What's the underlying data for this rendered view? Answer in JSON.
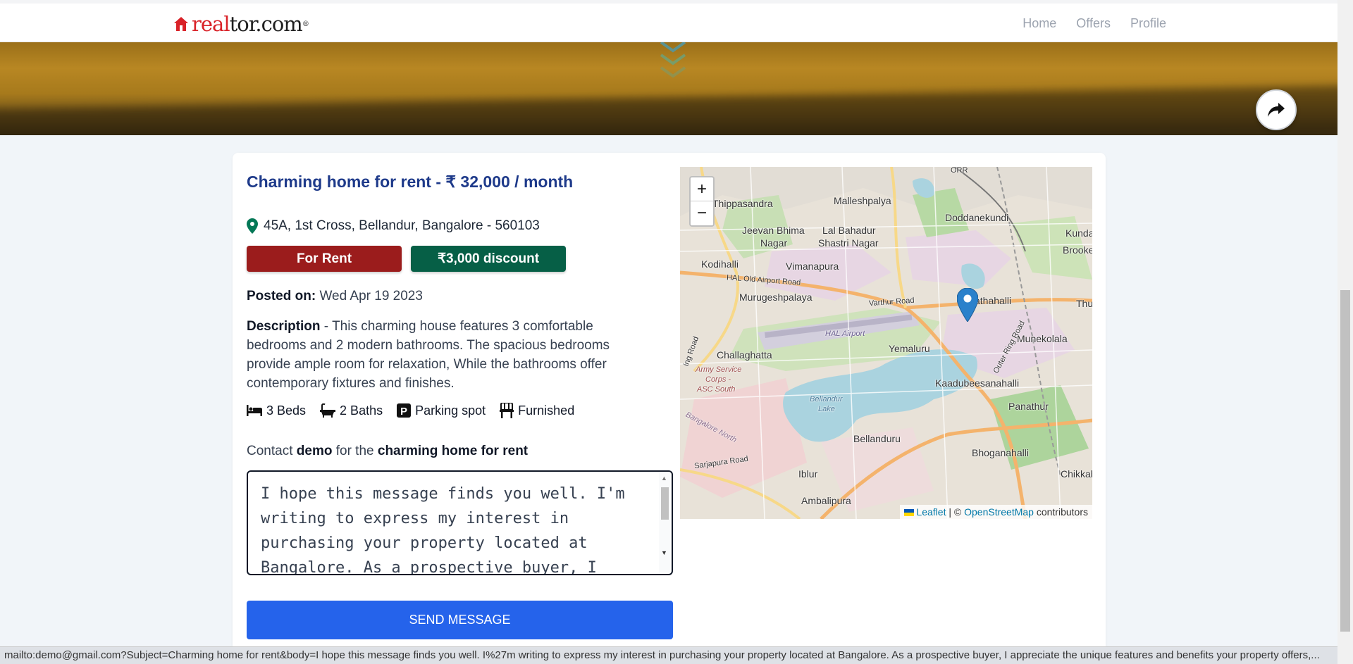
{
  "header": {
    "logo_red": "real",
    "logo_dark": "tor.com",
    "nav": [
      {
        "label": "Home"
      },
      {
        "label": "Offers"
      },
      {
        "label": "Profile"
      }
    ]
  },
  "listing": {
    "title": "Charming home for rent - ₹ 32,000 / month",
    "address": "45A, 1st Cross, Bellandur, Bangalore - 560103",
    "badge_type": "For Rent",
    "badge_discount": "₹3,000 discount",
    "posted_label": "Posted on:",
    "posted_date": "Wed Apr 19 2023",
    "description_label": "Description",
    "description": " - This charming house features 3 comfortable bedrooms and 2 modern bathrooms. The spacious bedrooms provide ample room for relaxation, While the bathrooms offer contemporary fixtures and finishes.",
    "features": [
      {
        "icon": "bed-icon",
        "label": "3 Beds"
      },
      {
        "icon": "bathtub-icon",
        "label": "2 Baths"
      },
      {
        "icon": "parking-icon",
        "label": "Parking spot"
      },
      {
        "icon": "chair-icon",
        "label": "Furnished"
      }
    ]
  },
  "contact": {
    "prefix": "Contact ",
    "name": "demo",
    "middle": " for the ",
    "subject": "charming home for rent",
    "message": "I hope this message finds you well. I'm writing to express my interest in purchasing your property located at Bangalore. As a prospective buyer, I",
    "send_label": "SEND MESSAGE"
  },
  "map": {
    "zoom_in": "+",
    "zoom_out": "−",
    "attribution_leaflet": "Leaflet",
    "attribution_sep": " | © ",
    "attribution_osm": "OpenStreetMap",
    "attribution_suffix": " contributors",
    "labels": {
      "orr": "ORR",
      "thippasandra": "Thippasandra",
      "malleshpalya": "Malleshpalya",
      "doddanekundi": "Doddanekundi",
      "kunda": "Kunda",
      "jeevan_bhima": "Jeevan Bhima",
      "nagar1": "Nagar",
      "lal_bahadur": "Lal Bahadur",
      "shastri_nagar": "Shastri Nagar",
      "brooke": "Brooke",
      "kodihalli": "Kodihalli",
      "vimanapura": "Vimanapura",
      "hal_old_airport_road": "HAL Old Airport Road",
      "murugeshpalaya": "Murugeshpalaya",
      "varthur_road": "Varthur Road",
      "athahalli": "athahalli",
      "thu": "Thu",
      "hal_airport": "HAL Airport",
      "yemaluru": "Yemaluru",
      "munekolala": "Munekolala",
      "challaghatta": "Challaghatta",
      "army1": "Army Service",
      "army2": "Corps -",
      "army3": "ASC South",
      "kaadubeesanahalli": "Kaadubeesanahalli",
      "bellandur_lake1": "Bellandur",
      "bellandur_lake2": "Lake",
      "panathur": "Panathur",
      "outer_ring_road": "Outer Ring Road",
      "bangalore_north": "Bangalore North",
      "bellanduru": "Bellanduru",
      "bhoganahalli": "Bhoganahalli",
      "sarjapura_road": "Sarjapura Road",
      "iblur": "Iblur",
      "chikkab": "Chikkab",
      "ambalipura": "Ambalipura",
      "ring_road": "ing Road"
    }
  },
  "status_bar": "mailto:demo@gmail.com?Subject=Charming home for rent&body=I hope this message finds you well. I%27m writing to express my interest in purchasing your property located at Bangalore. As a prospective buyer, I appreciate the unique features and benefits your property offers,...",
  "colors": {
    "brand_red": "#d92228",
    "title_blue": "#1e3a8a",
    "rent_badge": "#9b1c1c",
    "discount_badge": "#065f46",
    "send_button": "#2563eb"
  }
}
